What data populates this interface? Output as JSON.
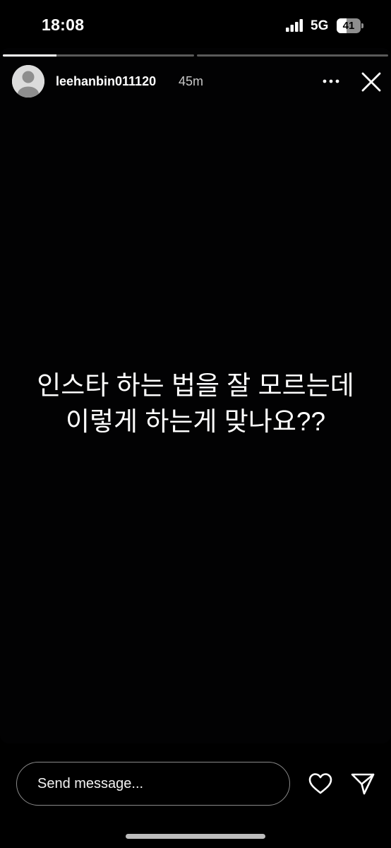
{
  "status_bar": {
    "time": "18:08",
    "network": "5G",
    "battery_level": "41",
    "battery_fraction": 0.41,
    "signal_bars": 4
  },
  "story": {
    "progress_segments": [
      {
        "progress": 0.28
      },
      {
        "progress": 0.0
      }
    ],
    "username": "leehanbin011120",
    "posted_ago": "45m",
    "text_lines": [
      "인스타 하는 법을 잘 모르는데",
      "이렇게 하는게 맞나요??"
    ],
    "icons": {
      "avatar": "default-profile-avatar",
      "more": "more-options-icon",
      "close": "close-icon"
    }
  },
  "bottom_bar": {
    "message_placeholder": "Send message...",
    "icons": {
      "like": "heart-icon",
      "share": "send-icon"
    }
  },
  "colors": {
    "background": "#000000",
    "text": "#ffffff",
    "input_border": "#8a8a8a"
  }
}
